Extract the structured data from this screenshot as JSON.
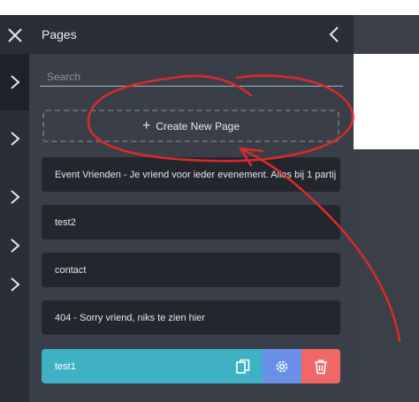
{
  "panel": {
    "title": "Pages",
    "search_placeholder": "Search",
    "create_label": "Create New Page"
  },
  "pages": [
    {
      "title": "Event Vrienden - Je vriend voor ieder evenement. Alles bij 1 partij"
    },
    {
      "title": "test2"
    },
    {
      "title": "contact"
    },
    {
      "title": "404 - Sorry vriend, niks te zien hier"
    }
  ],
  "active_page": {
    "title": "test1"
  },
  "icons": {
    "close": "close-icon",
    "collapse": "chevron-left-icon",
    "rail": "chevron-right-icon",
    "copy": "copy-icon",
    "settings": "gear-icon",
    "delete": "trash-icon",
    "add": "plus-icon"
  },
  "colors": {
    "active_page": "#3fb1c4",
    "settings_button": "#6a8fe6",
    "delete_button": "#ef6767",
    "annotation": "#d92a2a"
  }
}
